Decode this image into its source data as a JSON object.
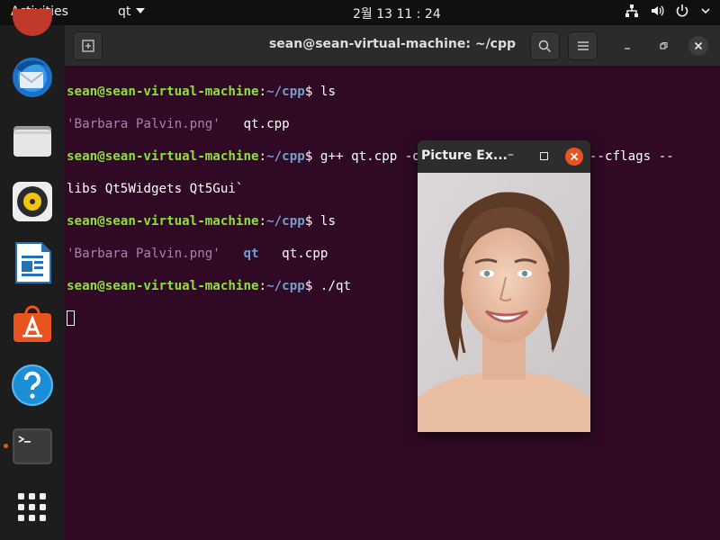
{
  "topbar": {
    "activities": "Activities",
    "app_menu": "qt",
    "clock": "2월 13  11 : 24",
    "tray_icons": [
      "network-icon",
      "volume-icon",
      "power-icon",
      "chevron-down-icon"
    ]
  },
  "dock": {
    "items": [
      {
        "name": "thunderbird",
        "icon": "thunderbird-icon"
      },
      {
        "name": "files",
        "icon": "files-icon"
      },
      {
        "name": "rhythmbox",
        "icon": "rhythmbox-icon"
      },
      {
        "name": "libreoffice-writer",
        "icon": "writer-icon"
      },
      {
        "name": "ubuntu-software",
        "icon": "software-icon"
      },
      {
        "name": "help",
        "icon": "help-icon"
      },
      {
        "name": "terminal",
        "icon": "terminal-icon",
        "running": true
      },
      {
        "name": "show-applications",
        "icon": "app-grid-icon"
      }
    ]
  },
  "terminal": {
    "title": "sean@sean-virtual-machine: ~/cpp",
    "prompt_user": "sean@sean-virtual-machine",
    "prompt_colon": ":",
    "prompt_path": "~/cpp",
    "prompt_dollar": "$",
    "cmd1": " ls",
    "ls1_png": "'Barbara Palvin.png'",
    "ls1_cpp": "   qt.cpp",
    "cmd2": " g++ qt.cpp -o qt -fPIC `pkg-config --cflags --",
    "cmd2_wrap": "libs Qt5Widgets Qt5Gui`",
    "cmd3": " ls",
    "ls2_png": "'Barbara Palvin.png'",
    "ls2_qt": "   qt",
    "ls2_cpp": "   qt.cpp",
    "cmd4": " ./qt",
    "colors": {
      "user": "#8ae234",
      "path": "#729fcf",
      "file_png": "#ad7fa8",
      "background": "#300a24"
    }
  },
  "picture_window": {
    "title": "Picture Ex...",
    "minimize": "–",
    "close_color": "#e95420"
  }
}
